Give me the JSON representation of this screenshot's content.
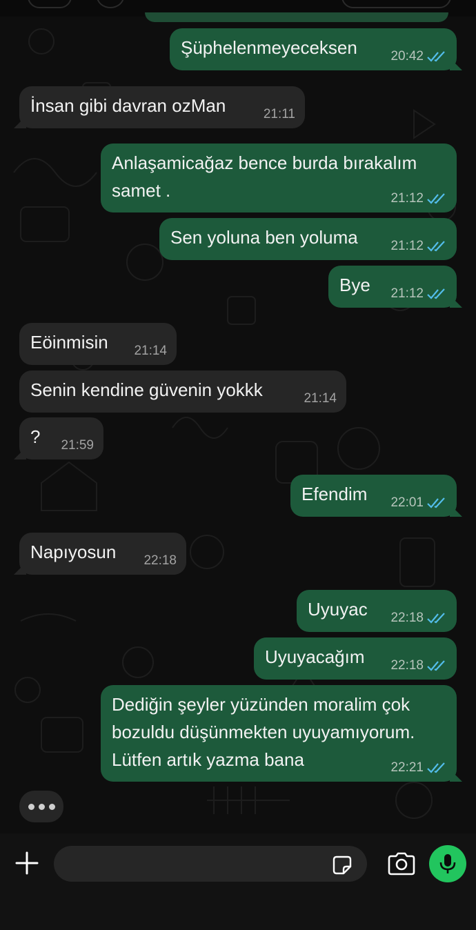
{
  "composer": {
    "placeholder": ""
  },
  "colors": {
    "outgoing_bubble": "#1d5a3b",
    "incoming_bubble": "#262626",
    "read_ticks": "#53bdeb",
    "mic_button": "#22c55e"
  },
  "icons": {
    "add": "plus-icon",
    "sticker": "sticker-icon",
    "camera": "camera-icon",
    "mic": "microphone-icon",
    "read": "double-check-icon"
  },
  "messages": [
    {
      "dir": "out",
      "text": "Şüphelenmeyeceksen",
      "time": "20:42",
      "read": true
    },
    {
      "dir": "in",
      "text": "İnsan gibi davran ozMan",
      "time": "21:11"
    },
    {
      "dir": "out",
      "text": "Anlaşamicağaz bence burda bırakalım samet .",
      "time": "21:12",
      "read": true
    },
    {
      "dir": "out",
      "text": "Sen yoluna ben yoluma",
      "time": "21:12",
      "read": true
    },
    {
      "dir": "out",
      "text": "Bye",
      "time": "21:12",
      "read": true
    },
    {
      "dir": "in",
      "text": "Eöinmisin",
      "time": "21:14"
    },
    {
      "dir": "in",
      "text": "Senin kendine güvenin yokkk",
      "time": "21:14"
    },
    {
      "dir": "in",
      "text": "?",
      "time": "21:59"
    },
    {
      "dir": "out",
      "text": "Efendim",
      "time": "22:01",
      "read": true
    },
    {
      "dir": "in",
      "text": "Napıyosun",
      "time": "22:18"
    },
    {
      "dir": "out",
      "text": "Uyuyac",
      "time": "22:18",
      "read": true
    },
    {
      "dir": "out",
      "text": "Uyuyacağım",
      "time": "22:18",
      "read": true
    },
    {
      "dir": "out",
      "text": "Dediğin şeyler yüzünden moralim çok bozuldu düşünmekten uyuyamıyorum. Lütfen artık yazma bana",
      "time": "22:21",
      "read": true
    }
  ]
}
